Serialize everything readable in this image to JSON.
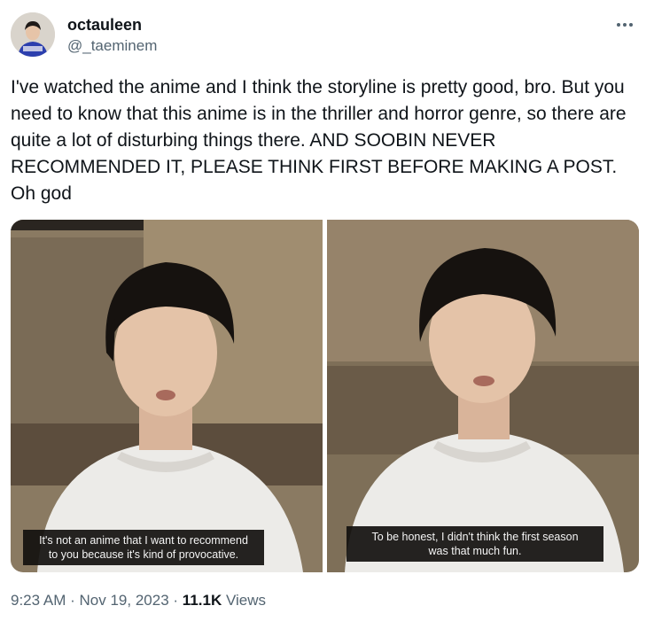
{
  "author": {
    "display_name": "octauleen",
    "handle": "@_taeminem"
  },
  "tweet": {
    "text": "I've watched the anime and I think the storyline is pretty good, bro. But you need to know that this anime is in the thriller and horror genre, so there are quite a lot of disturbing things there. AND SOOBIN NEVER RECOMMENDED IT, PLEASE THINK FIRST BEFORE MAKING A POST. Oh god"
  },
  "media": {
    "photos": [
      {
        "subtitle_line1": "It's not an anime that I want to recommend",
        "subtitle_line2": "to you because it's kind of provocative."
      },
      {
        "subtitle_line1": "To be honest, I didn't think the first season",
        "subtitle_line2": "was that much fun."
      }
    ]
  },
  "meta": {
    "time": "9:23 AM",
    "separator": "·",
    "date": "Nov 19, 2023",
    "views_count": "11.1K",
    "views_label": "Views"
  },
  "colors": {
    "text_primary": "#0f1419",
    "text_secondary": "#536471"
  },
  "icons": {
    "more": "more-dots-icon"
  }
}
